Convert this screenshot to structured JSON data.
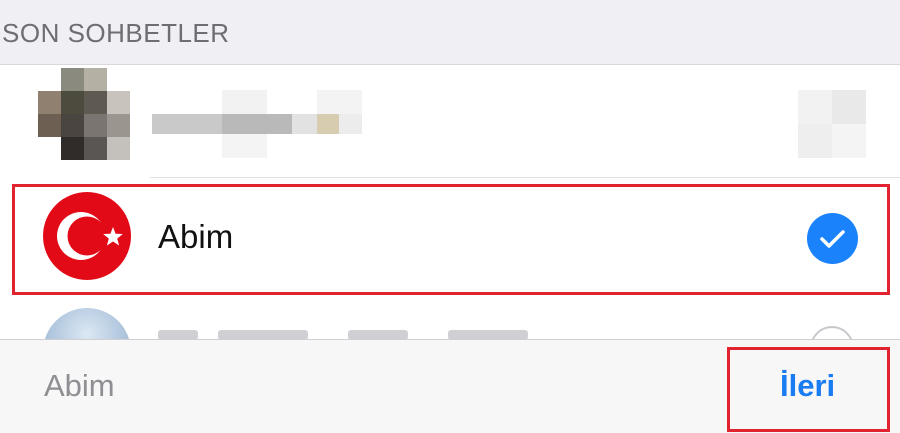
{
  "section": {
    "title": "SON SOHBETLER"
  },
  "rows": [
    {
      "name": "",
      "state": "blurred"
    },
    {
      "name": "Abim",
      "selected": true,
      "avatar_icon": "turkish-flag-icon",
      "check_icon": "checkmark-icon"
    },
    {
      "name": "",
      "state": "partially-visible",
      "selected": false
    }
  ],
  "bottom_bar": {
    "selected_label": "Abim",
    "next_label": "İleri"
  },
  "colors": {
    "accent": "#1a82fb",
    "next_text": "#1a7cf2",
    "highlight": "#e0232f",
    "flag_red": "#e30a17",
    "header_bg": "#efeff4"
  }
}
